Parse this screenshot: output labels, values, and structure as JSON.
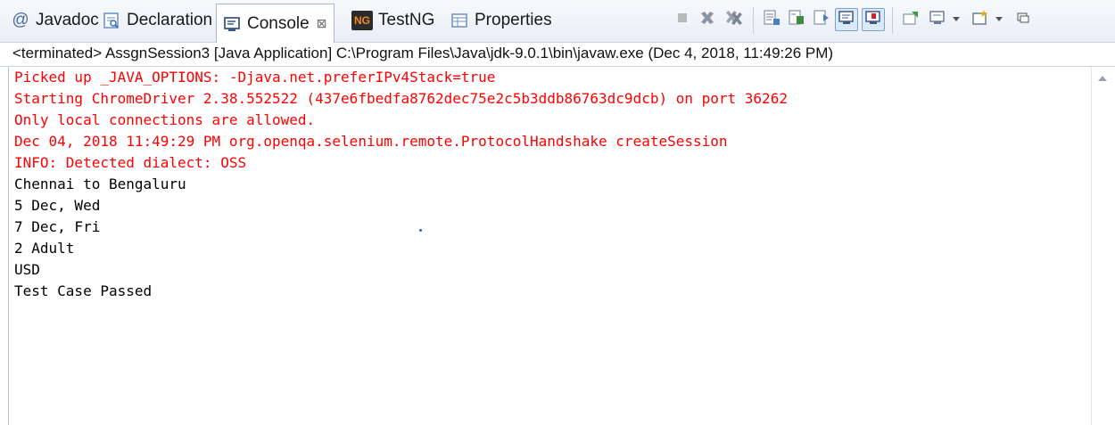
{
  "tabs": [
    {
      "label": "Javadoc",
      "icon": "at-sign-icon"
    },
    {
      "label": "Declaration",
      "icon": "declaration-icon"
    },
    {
      "label": "Console",
      "icon": "console-icon",
      "active": true,
      "close": "⊠"
    },
    {
      "label": "TestNG",
      "icon": "testng-icon"
    },
    {
      "label": "Properties",
      "icon": "properties-icon"
    }
  ],
  "icons": {
    "at_glyph": "@",
    "testng_glyph": "NG"
  },
  "status_line": "<terminated> AssgnSession3 [Java Application] C:\\Program Files\\Java\\jdk-9.0.1\\bin\\javaw.exe (Dec 4, 2018, 11:49:26 PM)",
  "console": {
    "lines": [
      {
        "text": "Picked up _JAVA_OPTIONS: -Djava.net.preferIPv4Stack=true",
        "stream": "err"
      },
      {
        "text": "Starting ChromeDriver 2.38.552522 (437e6fbedfa8762dec75e2c5b3ddb86763dc9dcb) on port 36262",
        "stream": "err"
      },
      {
        "text": "Only local connections are allowed.",
        "stream": "err"
      },
      {
        "text": "Dec 04, 2018 11:49:29 PM org.openqa.selenium.remote.ProtocolHandshake createSession",
        "stream": "err"
      },
      {
        "text": "INFO: Detected dialect: OSS",
        "stream": "err"
      },
      {
        "text": "Chennai to Bengaluru",
        "stream": "out"
      },
      {
        "text": "5 Dec, Wed",
        "stream": "out"
      },
      {
        "text": "7 Dec, Fri",
        "stream": "out"
      },
      {
        "text": "2 Adult",
        "stream": "out"
      },
      {
        "text": "USD",
        "stream": "out"
      },
      {
        "text": "Test Case Passed",
        "stream": "out"
      }
    ]
  },
  "colors": {
    "stderr": "#ff0000",
    "stdout": "#000000",
    "tab_bar": "#e9eef5"
  },
  "toolbar": {
    "terminate_icon": "terminate-icon",
    "remove_launch_icon": "remove-launch-icon",
    "remove_all_icon": "remove-all-terminated-icon",
    "scroll_lock_icon": "scroll-lock-icon",
    "word_wrap_icon": "word-wrap-icon",
    "show_console_icon": "show-console-on-output-icon",
    "pin_console_icon": "pin-console-icon",
    "show_stdout_icon": "show-stdout-icon",
    "open_console_icon": "open-console-icon",
    "display_selected_icon": "display-selected-console-icon",
    "new_console_icon": "new-console-icon",
    "minimize_icon": "minimize-icon"
  }
}
